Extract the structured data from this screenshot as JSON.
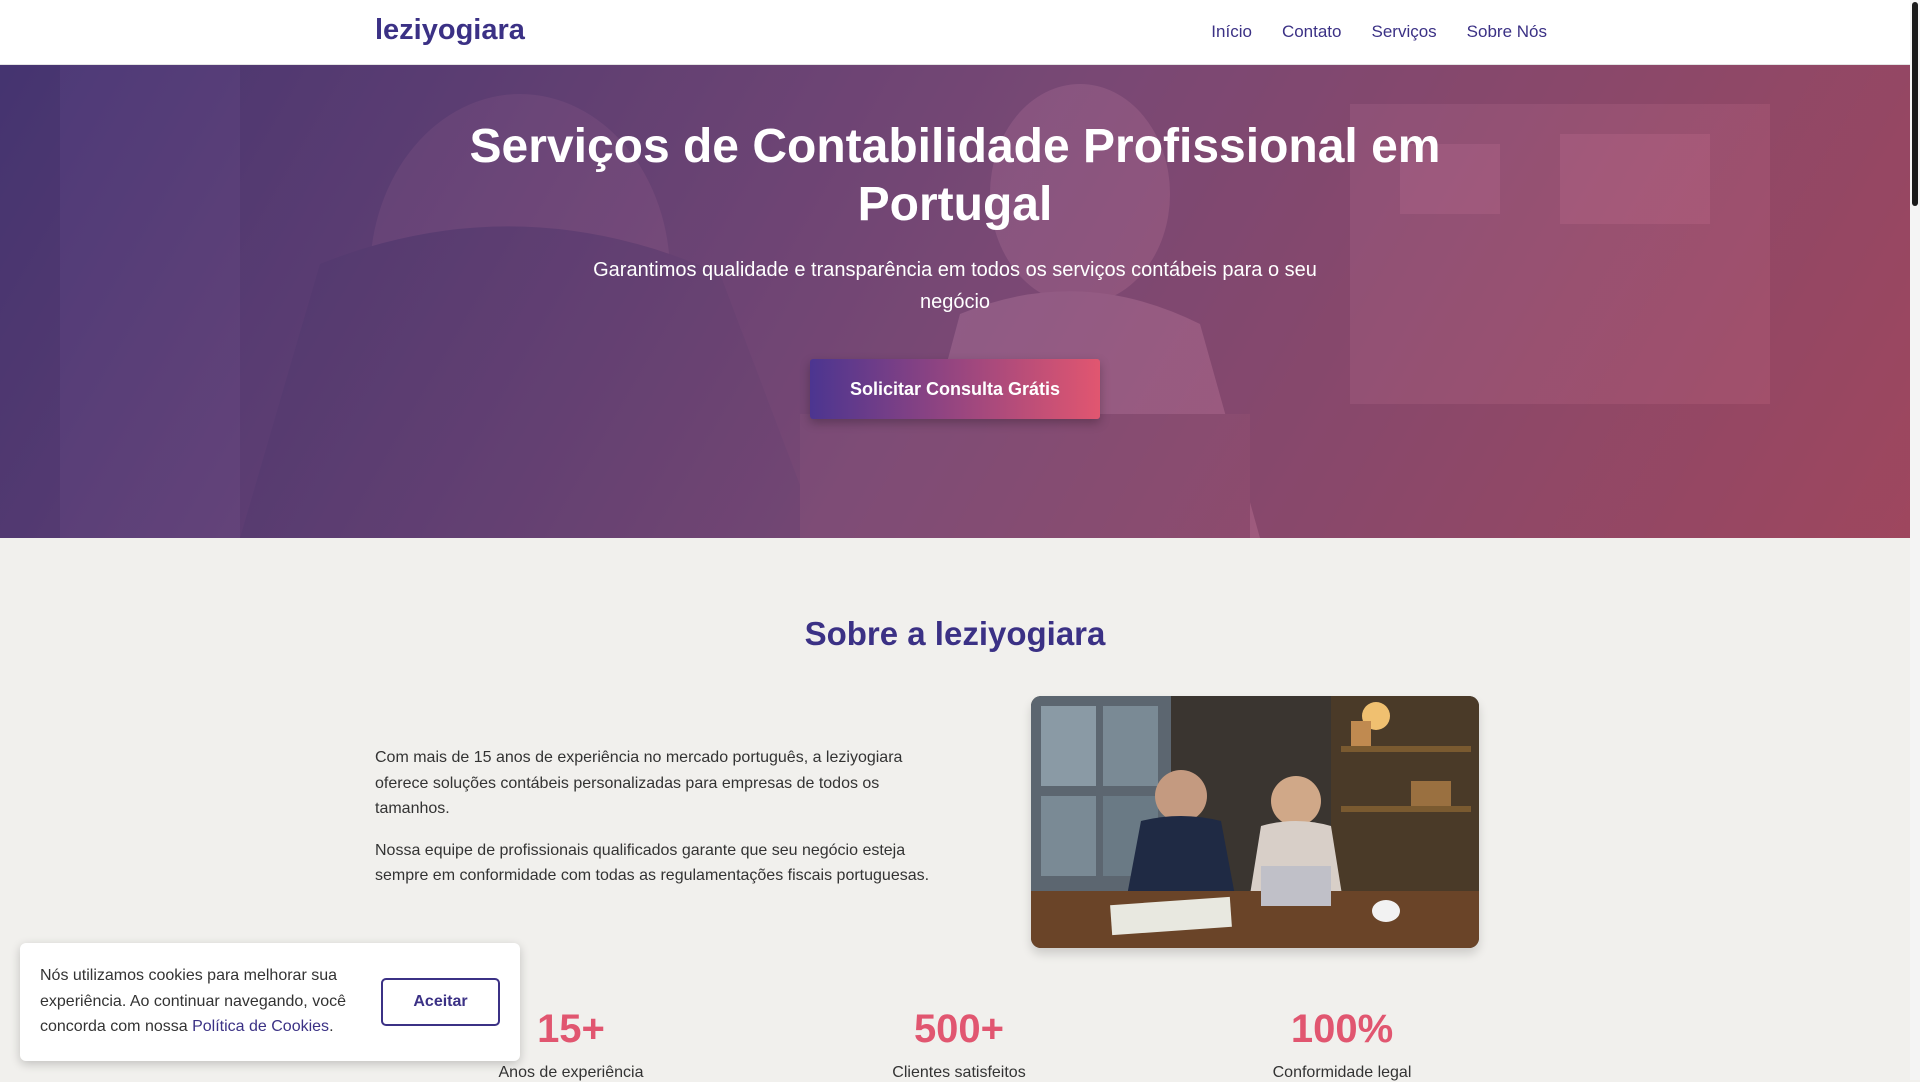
{
  "header": {
    "logo": "leziyogiara",
    "nav": [
      "Início",
      "Contato",
      "Serviços",
      "Sobre Nós"
    ]
  },
  "hero": {
    "title": "Serviços de Contabilidade Profissional em Portugal",
    "subtitle": "Garantimos qualidade e transparência em todos os serviços contábeis para o seu negócio",
    "cta": "Solicitar Consulta Grátis"
  },
  "about": {
    "title": "Sobre a leziyogiara",
    "paragraphs": [
      "Com mais de 15 anos de experiência no mercado português, a leziyogiara oferece soluções contábeis personalizadas para empresas de todos os tamanhos.",
      "Nossa equipe de profissionais qualificados garante que seu negócio esteja sempre em conformidade com todas as regulamentações fiscais portuguesas."
    ]
  },
  "stats": [
    {
      "value": "15+",
      "label": "Anos de experiência"
    },
    {
      "value": "500+",
      "label": "Clientes satisfeitos"
    },
    {
      "value": "100%",
      "label": "Conformidade legal"
    }
  ],
  "cookie": {
    "text": "Nós utilizamos cookies para melhorar sua experiência. Ao continuar navegando, você concorda com nossa",
    "link": "Política de Cookies",
    "suffix": ".",
    "accept": "Aceitar"
  },
  "colors": {
    "primary": "#3b3185",
    "accent": "#e15670",
    "background": "#f1f0ed"
  }
}
